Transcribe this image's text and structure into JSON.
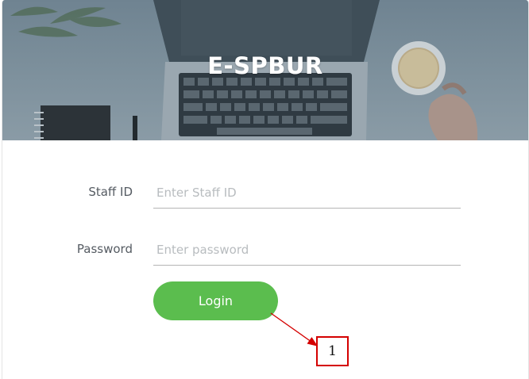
{
  "header": {
    "title": "E-SPBUR"
  },
  "form": {
    "staff_id_label": "Staff ID",
    "staff_id_placeholder": "Enter Staff ID",
    "password_label": "Password",
    "password_placeholder": "Enter password",
    "login_label": "Login"
  },
  "annotation": {
    "marker": "1"
  },
  "colors": {
    "accent": "#5bbd4e",
    "callout": "#d40000",
    "header_overlay": "#7e919d"
  }
}
